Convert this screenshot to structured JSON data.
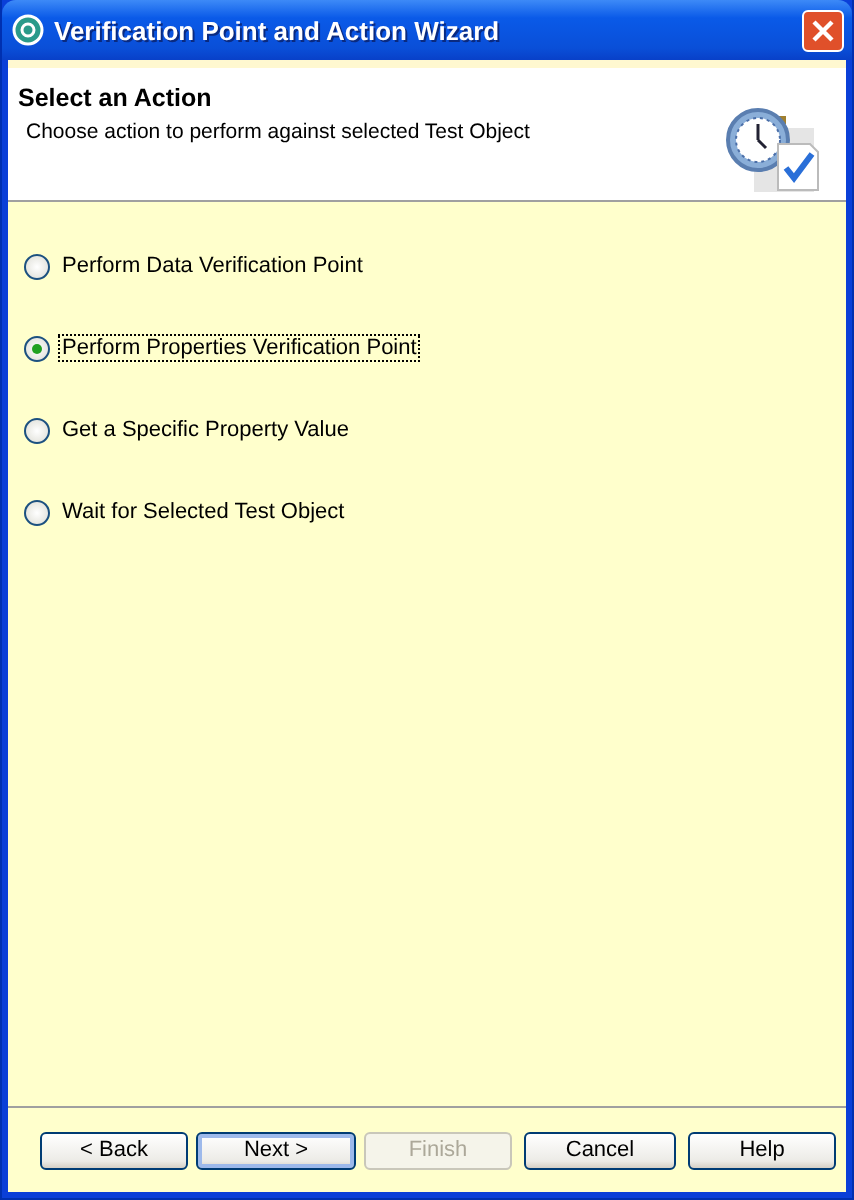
{
  "window": {
    "title": "Verification Point and Action Wizard"
  },
  "header": {
    "title": "Select an Action",
    "description": "Choose action to perform against selected Test Object"
  },
  "options": [
    {
      "label": "Perform Data Verification Point",
      "selected": false
    },
    {
      "label": "Perform Properties Verification Point",
      "selected": true
    },
    {
      "label": "Get a Specific Property Value",
      "selected": false
    },
    {
      "label": "Wait for Selected Test Object",
      "selected": false
    }
  ],
  "buttons": [
    {
      "label": "< Back",
      "disabled": false,
      "default": false
    },
    {
      "label": "Next >",
      "disabled": false,
      "default": true
    },
    {
      "label": "Finish",
      "disabled": true,
      "default": false
    },
    {
      "label": "Cancel",
      "disabled": false,
      "default": false
    },
    {
      "label": "Help",
      "disabled": false,
      "default": false
    }
  ]
}
